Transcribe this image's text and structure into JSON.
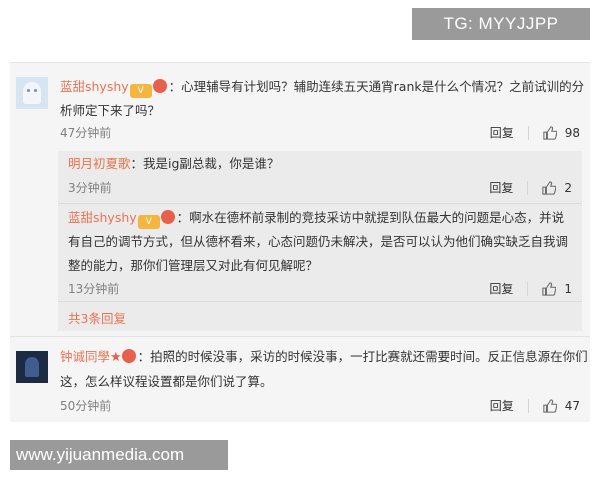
{
  "watermarks": {
    "top": "TG: MYYJJPP",
    "bottom": "www.yijuanmedia.com"
  },
  "comments": [
    {
      "user": "蓝甜shyshy",
      "text": "：心理辅导有计划吗？辅助连续五天通宵rank是什么个情况？之前试训的分析师定下来了吗？",
      "time": "47分钟前",
      "reply_label": "回复",
      "likes": "98",
      "replies": [
        {
          "user": "明月初夏歌",
          "text": "：我是ig副总裁，你是谁？",
          "time": "3分钟前",
          "reply_label": "回复",
          "likes": "2"
        },
        {
          "user": "蓝甜shyshy",
          "text": "：啊水在德杯前录制的竞技采访中就提到队伍最大的问题是心态，并说有自己的调节方式，但从德杯看来，心态问题仍未解决，是否可以认为他们确实缺乏自我调整的能力，那你们管理层又对此有何见解呢？",
          "time": "13分钟前",
          "reply_label": "回复",
          "likes": "1"
        }
      ],
      "more_replies": "共3条回复"
    },
    {
      "user": "钟诚同學",
      "text": "：拍照的时候没事，采访的时候没事，一打比赛就还需要时间。反正信息源在你们这，怎么样议程设置都是你们说了算。",
      "time": "50分钟前",
      "reply_label": "回复",
      "likes": "47"
    }
  ],
  "colors": {
    "username": "#eb7350",
    "panel_bg": "#f5f5f5",
    "sub_bg": "#ebebeb",
    "watermark_bg": "#9a9a9a"
  },
  "icons": {
    "like": "thumbs-up-icon",
    "vip": "vip-badge-icon",
    "star": "star-icon"
  }
}
